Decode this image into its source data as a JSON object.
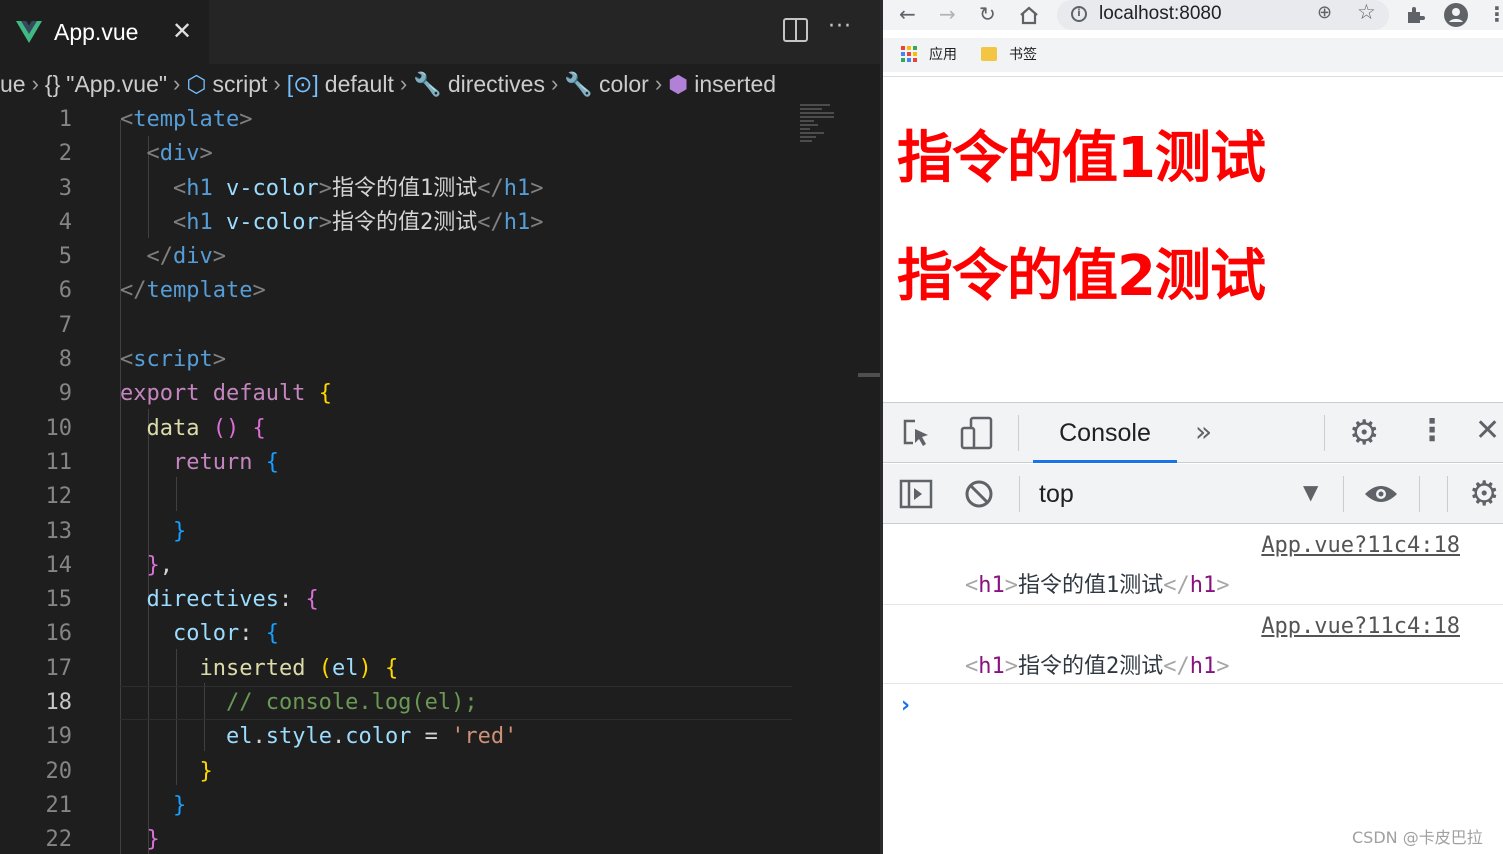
{
  "editor": {
    "tab": {
      "filename": "App.vue",
      "close": "✕"
    },
    "breadcrumb": {
      "items": [
        "ue",
        "\"App.vue\"",
        "script",
        "default",
        "directives",
        "color",
        "inserted"
      ],
      "icons": [
        "",
        "{}",
        "⬡",
        "[⊙]",
        "🔧",
        "🔧",
        "⬢"
      ]
    },
    "current_line": 18,
    "lines": [
      [
        {
          "t": "<",
          "c": "t-br"
        },
        {
          "t": "template",
          "c": "t-tag"
        },
        {
          "t": ">",
          "c": "t-br"
        }
      ],
      [
        {
          "t": "  <",
          "c": "t-br"
        },
        {
          "t": "div",
          "c": "t-tag"
        },
        {
          "t": ">",
          "c": "t-br"
        }
      ],
      [
        {
          "t": "    <",
          "c": "t-br"
        },
        {
          "t": "h1",
          "c": "t-tag"
        },
        {
          "t": " v-color",
          "c": "t-attr"
        },
        {
          "t": ">",
          "c": "t-br"
        },
        {
          "t": "指令的值1测试",
          "c": "t-text"
        },
        {
          "t": "</",
          "c": "t-br"
        },
        {
          "t": "h1",
          "c": "t-tag"
        },
        {
          "t": ">",
          "c": "t-br"
        }
      ],
      [
        {
          "t": "    <",
          "c": "t-br"
        },
        {
          "t": "h1",
          "c": "t-tag"
        },
        {
          "t": " v-color",
          "c": "t-attr"
        },
        {
          "t": ">",
          "c": "t-br"
        },
        {
          "t": "指令的值2测试",
          "c": "t-text"
        },
        {
          "t": "</",
          "c": "t-br"
        },
        {
          "t": "h1",
          "c": "t-tag"
        },
        {
          "t": ">",
          "c": "t-br"
        }
      ],
      [
        {
          "t": "  </",
          "c": "t-br"
        },
        {
          "t": "div",
          "c": "t-tag"
        },
        {
          "t": ">",
          "c": "t-br"
        }
      ],
      [
        {
          "t": "</",
          "c": "t-br"
        },
        {
          "t": "template",
          "c": "t-tag"
        },
        {
          "t": ">",
          "c": "t-br"
        }
      ],
      [],
      [
        {
          "t": "<",
          "c": "t-br"
        },
        {
          "t": "script",
          "c": "t-tag"
        },
        {
          "t": ">",
          "c": "t-br"
        }
      ],
      [
        {
          "t": "export default ",
          "c": "t-kw"
        },
        {
          "t": "{",
          "c": "t-gold"
        }
      ],
      [
        {
          "t": "  ",
          "c": "t-plain"
        },
        {
          "t": "data",
          "c": "t-fn"
        },
        {
          "t": " ",
          "c": "t-plain"
        },
        {
          "t": "()",
          "c": "t-pink"
        },
        {
          "t": " ",
          "c": "t-plain"
        },
        {
          "t": "{",
          "c": "t-pink"
        }
      ],
      [
        {
          "t": "    ",
          "c": "t-plain"
        },
        {
          "t": "return",
          "c": "t-kw"
        },
        {
          "t": " ",
          "c": "t-plain"
        },
        {
          "t": "{",
          "c": "t-blue"
        }
      ],
      [],
      [
        {
          "t": "    ",
          "c": "t-plain"
        },
        {
          "t": "}",
          "c": "t-blue"
        }
      ],
      [
        {
          "t": "  ",
          "c": "t-plain"
        },
        {
          "t": "}",
          "c": "t-pink"
        },
        {
          "t": ",",
          "c": "t-plain"
        }
      ],
      [
        {
          "t": "  ",
          "c": "t-plain"
        },
        {
          "t": "directives",
          "c": "t-prop"
        },
        {
          "t": ": ",
          "c": "t-plain"
        },
        {
          "t": "{",
          "c": "t-pink"
        }
      ],
      [
        {
          "t": "    ",
          "c": "t-plain"
        },
        {
          "t": "color",
          "c": "t-prop"
        },
        {
          "t": ": ",
          "c": "t-plain"
        },
        {
          "t": "{",
          "c": "t-blue"
        }
      ],
      [
        {
          "t": "      ",
          "c": "t-plain"
        },
        {
          "t": "inserted",
          "c": "t-fn"
        },
        {
          "t": " ",
          "c": "t-plain"
        },
        {
          "t": "(",
          "c": "t-gold"
        },
        {
          "t": "el",
          "c": "t-prop"
        },
        {
          "t": ")",
          "c": "t-gold"
        },
        {
          "t": " ",
          "c": "t-plain"
        },
        {
          "t": "{",
          "c": "t-gold"
        }
      ],
      [
        {
          "t": "        ",
          "c": "t-plain"
        },
        {
          "t": "// console.log(el);",
          "c": "t-com"
        }
      ],
      [
        {
          "t": "        ",
          "c": "t-plain"
        },
        {
          "t": "el",
          "c": "t-prop"
        },
        {
          "t": ".",
          "c": "t-plain"
        },
        {
          "t": "style",
          "c": "t-prop"
        },
        {
          "t": ".",
          "c": "t-plain"
        },
        {
          "t": "color",
          "c": "t-prop"
        },
        {
          "t": " = ",
          "c": "t-plain"
        },
        {
          "t": "'red'",
          "c": "t-str"
        }
      ],
      [
        {
          "t": "      ",
          "c": "t-plain"
        },
        {
          "t": "}",
          "c": "t-gold"
        }
      ],
      [
        {
          "t": "    ",
          "c": "t-plain"
        },
        {
          "t": "}",
          "c": "t-blue"
        }
      ],
      [
        {
          "t": "  ",
          "c": "t-plain"
        },
        {
          "t": "}",
          "c": "t-pink"
        }
      ]
    ]
  },
  "browser": {
    "url": "localhost:8080",
    "bookmarks": [
      {
        "label": "应用",
        "icon": "apps-grid-icon"
      },
      {
        "label": "书签",
        "icon": "folder-icon"
      }
    ],
    "page": {
      "headings": [
        "指令的值1测试",
        "指令的值2测试"
      ],
      "heading_color": "#ff0000"
    },
    "devtools": {
      "tab": "Console",
      "context": "top",
      "logs": [
        {
          "source": "App.vue?11c4:18",
          "open": "<",
          "tag": "h1",
          "close_bracket": ">",
          "text": "指令的值1测试",
          "end_open": "</",
          "end_close": ">"
        },
        {
          "source": "App.vue?11c4:18",
          "open": "<",
          "tag": "h1",
          "close_bracket": ">",
          "text": "指令的值2测试",
          "end_open": "</",
          "end_close": ">"
        }
      ],
      "prompt": "›"
    }
  },
  "watermark": "CSDN @卡皮巴拉"
}
